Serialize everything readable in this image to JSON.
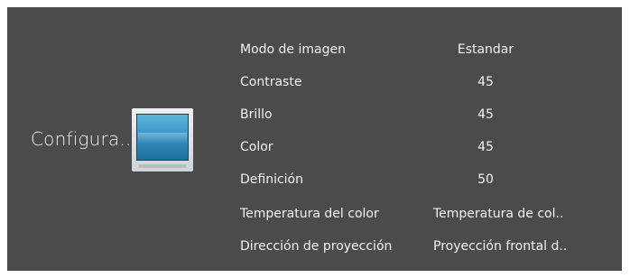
{
  "section": {
    "title": "Configura...",
    "icon": "picture-settings-icon"
  },
  "settings": [
    {
      "label": "Modo de imagen",
      "value": "Estandar"
    },
    {
      "label": "Contraste",
      "value": "45"
    },
    {
      "label": "Brillo",
      "value": "45"
    },
    {
      "label": "Color",
      "value": "45"
    },
    {
      "label": "Definición",
      "value": "50"
    },
    {
      "label": "Temperatura del color",
      "value": "Temperatura de col.."
    },
    {
      "label": "Dirección de proyección",
      "value": "Proyección frontal d.."
    }
  ],
  "colors": {
    "panel_background": "#4b4b4b",
    "text": "#f3f3f3",
    "icon_accent": "#3f9ccc"
  }
}
